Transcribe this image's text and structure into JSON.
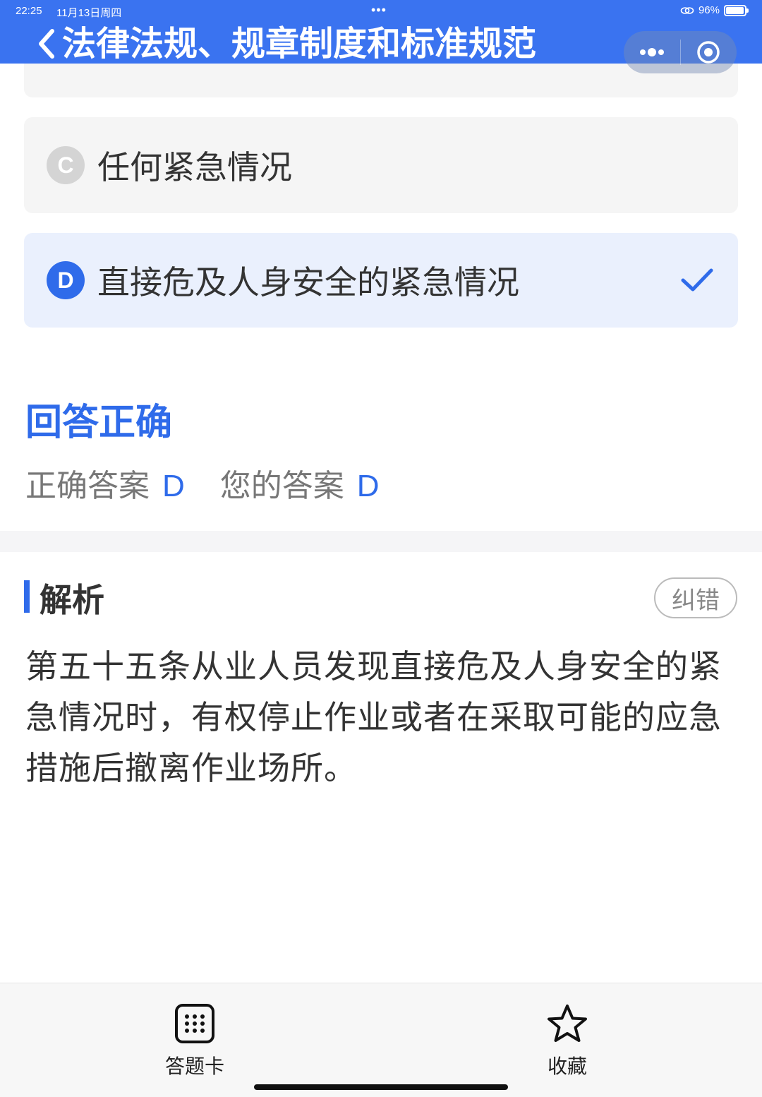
{
  "status_bar": {
    "time": "22:25",
    "date": "11月13日周四",
    "dots": "•••",
    "battery": "96%"
  },
  "nav": {
    "title": "法律法规、规章制度和标准规范"
  },
  "options": [
    {
      "letter": "C",
      "text": "任何紧急情况",
      "selected": false
    },
    {
      "letter": "D",
      "text": "直接危及人身安全的紧急情况",
      "selected": true
    }
  ],
  "result": {
    "title": "回答正确",
    "correct_label": "正确答案",
    "correct_value": "D",
    "yours_label": "您的答案",
    "yours_value": "D"
  },
  "analysis": {
    "title": "解析",
    "report_label": "纠错",
    "text": "第五十五条从业人员发现直接危及人身安全的紧急情况时，有权停止作业或者在采取可能的应急措施后撤离作业场所。"
  },
  "toolbar": {
    "answer_card_label": "答题卡",
    "favorite_label": "收藏"
  },
  "colors": {
    "accent": "#2f6bea",
    "header": "#3a73f0"
  }
}
